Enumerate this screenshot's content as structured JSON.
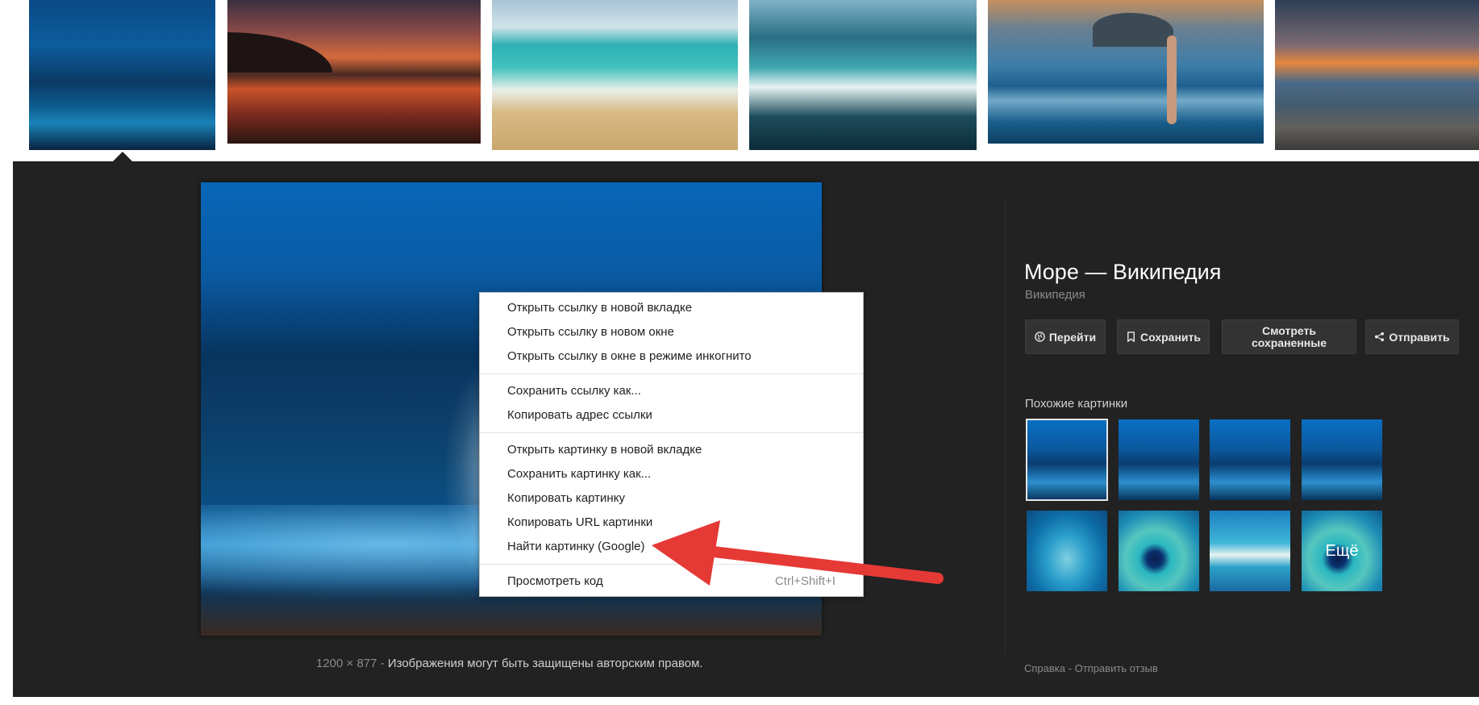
{
  "thumbnails": [
    {
      "name": "night-sea"
    },
    {
      "name": "sunset-coast"
    },
    {
      "name": "sandy-beach"
    },
    {
      "name": "waves"
    },
    {
      "name": "girl-in-sea"
    },
    {
      "name": "pebble-beach-sunset"
    }
  ],
  "preview": {
    "dimensions": "1200 × 877",
    "separator": "-",
    "copyright": "Изображения могут быть защищены авторским правом."
  },
  "info": {
    "title": "Море — Википедия",
    "source": "Википедия",
    "buttons": {
      "visit": "Перейти",
      "save": "Сохранить",
      "view_saved_line1": "Смотреть",
      "view_saved_line2": "сохраненные",
      "share": "Отправить"
    },
    "similar_title": "Похожие картинки",
    "more_label": "Ещё"
  },
  "footer": {
    "help": "Справка",
    "sep": "-",
    "feedback": "Отправить отзыв"
  },
  "context_menu": {
    "items": [
      "Открыть ссылку в новой вкладке",
      "Открыть ссылку в новом окне",
      "Открыть ссылку в окне в режиме инкогнито",
      "Сохранить ссылку как...",
      "Копировать адрес ссылки",
      "Открыть картинку в новой вкладке",
      "Сохранить картинку как...",
      "Копировать картинку",
      "Копировать URL картинки",
      "Найти картинку (Google)",
      "Просмотреть код"
    ],
    "inspect_shortcut": "Ctrl+Shift+I"
  },
  "colors": {
    "panel": "#222222",
    "annotation_arrow": "#e53935"
  }
}
